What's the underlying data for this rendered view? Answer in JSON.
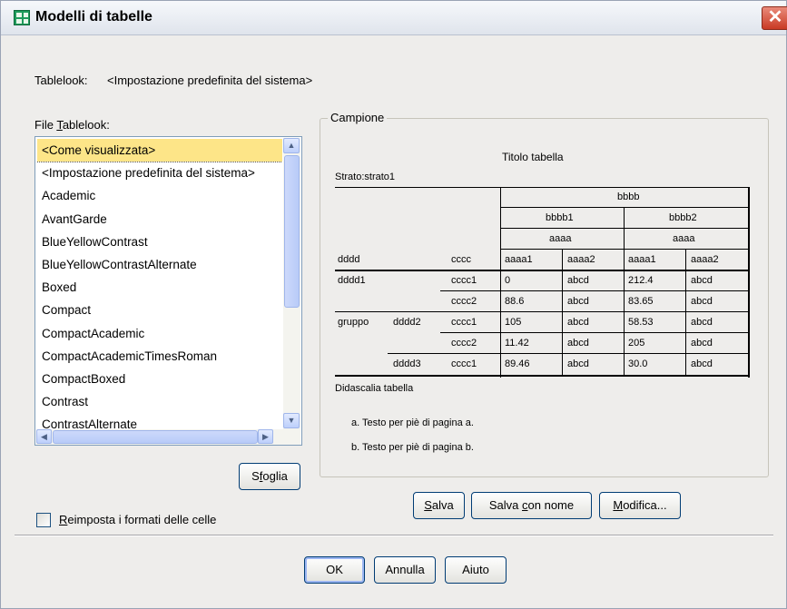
{
  "window": {
    "title": "Modelli di tabelle",
    "close_glyph": "✕"
  },
  "tablelook": {
    "label": "Tablelook:",
    "value": "<Impostazione predefinita del sistema>"
  },
  "files": {
    "label_pre": "File ",
    "label_u": "T",
    "label_post": "ablelook:",
    "items": [
      "<Come visualizzata>",
      "<Impostazione predefinita del sistema>",
      "Academic",
      "AvantGarde",
      "BlueYellowContrast",
      "BlueYellowContrastAlternate",
      "Boxed",
      "Compact",
      "CompactAcademic",
      "CompactAcademicTimesRoman",
      "CompactBoxed",
      "Contrast",
      "ContrastAlternate"
    ],
    "selected_index": 0
  },
  "browse_button": {
    "pre": "S",
    "u": "f",
    "post": "oglia"
  },
  "reset_checkbox": {
    "pre": "",
    "u": "R",
    "post": "eimposta i formati delle celle",
    "checked": false
  },
  "sample": {
    "legend": "Campione",
    "table_title": "Titolo tabella",
    "layer": "Strato:strato1",
    "col_top": "bbbb",
    "col_b1": "bbbb1",
    "col_b2": "bbbb2",
    "col_a_1": "aaaa",
    "col_a_2": "aaaa",
    "row_header_d": "dddd",
    "row_header_c": "cccc",
    "col_a1_1": "aaaa1",
    "col_a2_1": "aaaa2",
    "col_a1_2": "aaaa1",
    "col_a2_2": "aaaa2",
    "rows": [
      {
        "g": "dddd1",
        "d": "",
        "c": "cccc1",
        "v": [
          "0",
          "abcd",
          "212.4",
          "abcd"
        ]
      },
      {
        "g": "",
        "d": "",
        "c": "cccc2",
        "v": [
          "88.6",
          "abcd",
          "83.65",
          "abcd"
        ]
      },
      {
        "g": "gruppo",
        "d": "dddd2",
        "c": "cccc1",
        "v": [
          "105",
          "abcd",
          "58.53",
          "abcd"
        ]
      },
      {
        "g": "",
        "d": "",
        "c": "cccc2",
        "v": [
          "11.42",
          "abcd",
          "205",
          "abcd"
        ]
      },
      {
        "g": "",
        "d": "dddd3",
        "c": "cccc1",
        "v": [
          "89.46",
          "abcd",
          "30.0",
          "abcd"
        ]
      }
    ],
    "caption": "Didascalia tabella",
    "footnote_a": "a. Testo per piè di pagina a.",
    "footnote_b": "b. Testo per piè di pagina b."
  },
  "buttons": {
    "save": {
      "pre": "",
      "u": "S",
      "post": "alva"
    },
    "save_as": {
      "pre": "Salva ",
      "u": "c",
      "post": "on nome"
    },
    "edit": {
      "pre": "",
      "u": "M",
      "post": "odifica..."
    },
    "ok": "OK",
    "cancel": "Annulla",
    "help": "Aiuto"
  },
  "colors": {
    "selection": "#fde588",
    "button_border": "#003c74",
    "close_red": "#c93a24"
  }
}
